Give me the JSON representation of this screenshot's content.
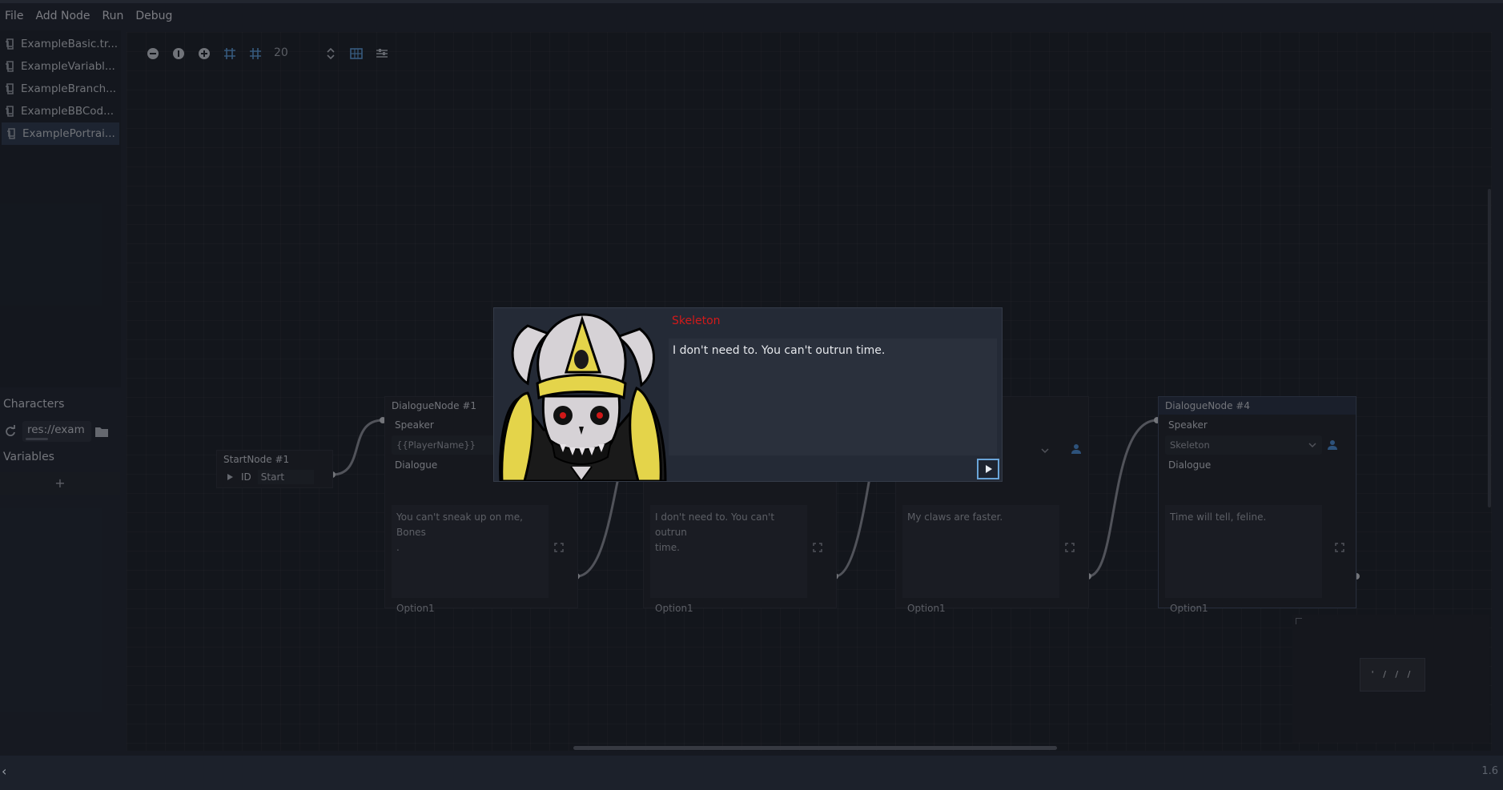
{
  "menu": {
    "file": "File",
    "add_node": "Add Node",
    "run": "Run",
    "debug": "Debug"
  },
  "files": [
    {
      "label": "ExampleBasic.tr..."
    },
    {
      "label": "ExampleVariabl..."
    },
    {
      "label": "ExampleBranch..."
    },
    {
      "label": "ExampleBBCod..."
    },
    {
      "label": "ExamplePortrai...",
      "selected": true
    }
  ],
  "characters": {
    "label": "Characters",
    "path": "res://exam"
  },
  "variables": {
    "label": "Variables",
    "add_label": "+"
  },
  "toolbar": {
    "zoom_value": "20"
  },
  "nodes": {
    "start": {
      "title": "StartNode #1",
      "id_label": "ID",
      "id_value": "Start"
    },
    "n1": {
      "title": "DialogueNode #1",
      "speaker_label": "Speaker",
      "speaker_value": "{{PlayerName}}",
      "dialogue_label": "Dialogue",
      "dialogue_text": "You can't sneak up on me, Bones\n.",
      "option": "Option1"
    },
    "n2": {
      "dialogue_text": "I don't need to. You can't outrun\ntime.",
      "option": "Option1"
    },
    "n3": {
      "dialogue_text": "My claws are faster.",
      "option": "Option1"
    },
    "n4": {
      "title": "DialogueNode #4",
      "speaker_label": "Speaker",
      "speaker_value": "Skeleton",
      "dialogue_label": "Dialogue",
      "dialogue_text": "Time will tell, feline.",
      "option": "Option1"
    }
  },
  "dialog": {
    "speaker": "Skeleton",
    "text": "I don't need to. You can't outrun time.",
    "speaker_color": "#d21a1a"
  },
  "minimap": {
    "label": "' / / /"
  },
  "footer": {
    "collapse": "‹",
    "version": "1.6"
  },
  "colors": {
    "accent": "#6aa4d8",
    "background": "#202531",
    "canvas": "#1b1f27"
  }
}
